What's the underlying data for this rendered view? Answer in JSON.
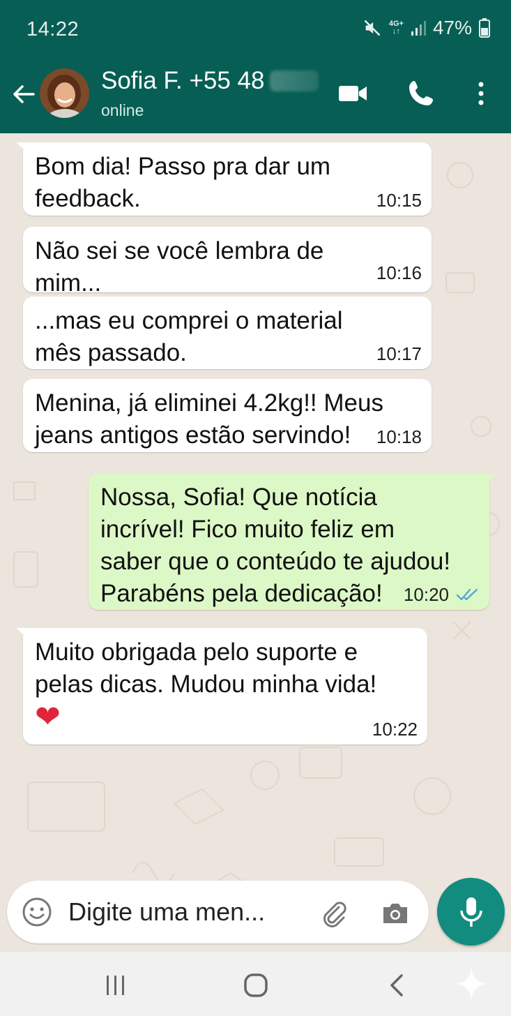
{
  "status_bar": {
    "time": "14:22",
    "network": "4G+",
    "battery": "47%",
    "icons": [
      "mute-icon",
      "network-4g-icon",
      "signal-icon",
      "battery-icon"
    ]
  },
  "header": {
    "contact_name": "Sofia F. +55 48",
    "status": "online",
    "icons": [
      "back-arrow-icon",
      "video-call-icon",
      "phone-icon",
      "more-vert-icon"
    ]
  },
  "messages": [
    {
      "direction": "in",
      "text": "Bom dia! Passo pra dar um\nfeedback.",
      "time": "10:15"
    },
    {
      "direction": "in",
      "text": "Não sei se você lembra de\nmim...",
      "time": "10:16"
    },
    {
      "direction": "in",
      "text": "...mas eu comprei o material\nmês passado.",
      "time": "10:17"
    },
    {
      "direction": "in",
      "text": "Menina, já eliminei 4.2kg!! Meus\njeans antigos estão servindo!",
      "time": "10:18"
    },
    {
      "direction": "out",
      "text": "Nossa, Sofia! Que notícia\nincrível! Fico muito feliz em\nsaber que o conteúdo te ajudou!\nParabéns pela dedicação!",
      "time": "10:20",
      "read": true
    },
    {
      "direction": "in",
      "text": "Muito obrigada pelo suporte e\npelas dicas. Mudou minha vida!",
      "emoji": "❤",
      "time": "10:22"
    }
  ],
  "composer": {
    "placeholder": "Digite uma men...",
    "icons": [
      "emoji-icon",
      "attach-icon",
      "camera-icon",
      "mic-icon"
    ]
  },
  "colors": {
    "header": "#075e54",
    "outgoing_bubble": "#dcf8c6",
    "incoming_bubble": "#ffffff",
    "mic_button": "#128c7e",
    "read_ticks": "#4fa9d9"
  }
}
